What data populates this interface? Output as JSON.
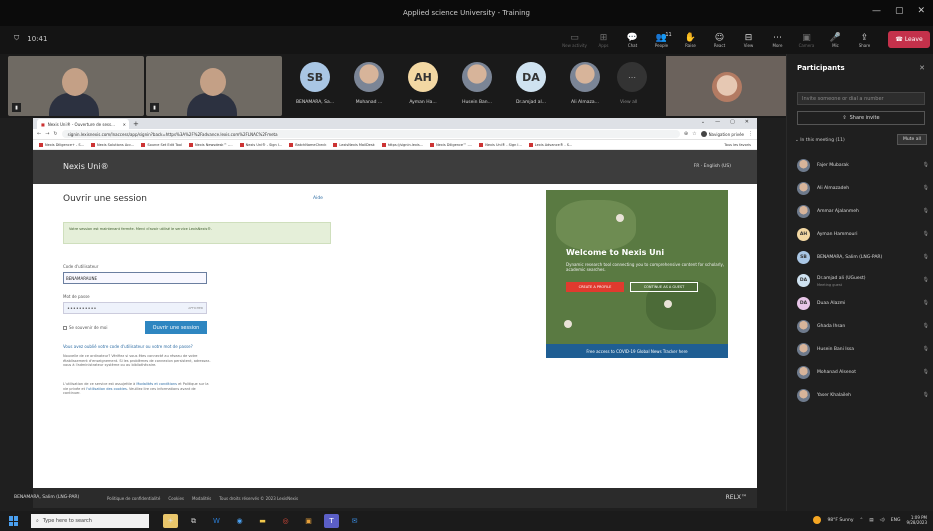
{
  "window": {
    "title": "Applied science University - Training",
    "controls": [
      "—",
      "▢",
      "✕"
    ]
  },
  "toolbar": {
    "timer": "10:41",
    "actions": [
      {
        "icon": "new-activity-icon",
        "glyph": "▭",
        "label": "New activity",
        "dim": true
      },
      {
        "icon": "apps-icon",
        "glyph": "⊞",
        "label": "Apps",
        "dim": true
      },
      {
        "icon": "chat-icon",
        "glyph": "💬",
        "label": "Chat",
        "dim": false
      },
      {
        "icon": "people-icon",
        "glyph": "👥",
        "label": "People",
        "dim": false
      },
      {
        "icon": "raise-hand-icon",
        "glyph": "✋",
        "label": "Raise",
        "dim": false
      },
      {
        "icon": "react-icon",
        "glyph": "☺",
        "label": "React",
        "dim": false
      },
      {
        "icon": "view-icon",
        "glyph": "⊟",
        "label": "View",
        "dim": false
      },
      {
        "icon": "more-icon",
        "glyph": "⋯",
        "label": "More",
        "dim": false
      },
      {
        "icon": "camera-icon",
        "glyph": "▣",
        "label": "Camera",
        "dim": true
      },
      {
        "icon": "mic-icon",
        "glyph": "🎤",
        "label": "Mic",
        "dim": false
      },
      {
        "icon": "share-icon",
        "glyph": "⇪",
        "label": "Share",
        "dim": false
      }
    ],
    "leave_label": "Leave",
    "people_count": "11"
  },
  "strip": {
    "tiles": [
      {
        "initials": "SB",
        "name": "BENAMARA, Sa...",
        "color": "#a9c6e4",
        "photo": false
      },
      {
        "initials": "",
        "name": "Mohanad ...",
        "color": "",
        "photo": true
      },
      {
        "initials": "AH",
        "name": "Ayman Ha...",
        "color": "#f3d8a3",
        "photo": false
      },
      {
        "initials": "",
        "name": "Husein Ban...",
        "color": "",
        "photo": true
      },
      {
        "initials": "DA",
        "name": "Dr.amjad al...",
        "color": "#cfe2f0",
        "photo": false
      },
      {
        "initials": "",
        "name": "Ali Almaza...",
        "color": "",
        "photo": true
      }
    ],
    "view_all": "View all"
  },
  "browser": {
    "tab_title": "Nexis Uni® - Ouverture de sess...",
    "url": "signin.lexisnexis.com/lnaccess/app/signin?back=https%3A%2F%2Fadvance.lexis.com%2FLNAC%2Fmeta",
    "private_label": "Navigation privée",
    "bookmarks": [
      "Nexis Diligence+ - S...",
      "Nexis Solutions Acc...",
      "Source Set Edit Tool",
      "Nexis Newsdesk™ -...",
      "Nexis Uni® - Sign I...",
      "BatchNameCheck",
      "LexisNexis MailDesk",
      "https://signin.lexis...",
      "Nexis Diligence™ -...",
      "Nexis Uni® - Sign I...",
      "Lexis Advance® - S..."
    ],
    "bookmarks_more": "Tous les favoris"
  },
  "nexis": {
    "logo": "Nexis Uni®",
    "lang": "FR · English (US)",
    "heading": "Ouvrir une session",
    "aide": "Aide",
    "notice": "Votre session est maintenant fermée. Merci d'avoir utilisé le service LexisNexis®.",
    "uid_label": "Code d'utilisateur",
    "uid_value": "BENAMARAUNE",
    "pwd_label": "Mot de passe",
    "pwd_value": "••••••••••",
    "pwd_toggle": "AFFICHER",
    "remember": "Se souvenir de moi",
    "submit": "Ouvrir une session",
    "forgot": "Vous avez oublié votre code d'utilisateur ou votre mot de passe?",
    "para1": "Nouvelle de ce ordinateur? Vérifiez si vous êtes connecté au réseau de votre établissement d'enseignement. Si les problèmes de connexion persistent, adressez-vous à l'administrateur système ou au bibliothécaire.",
    "para2_a": "L'utilisation de ce service est assujettie à ",
    "para2_link1": "Modalités et conditions",
    "para2_b": " et Politique sur la vie privée et ",
    "para2_link2": "l'utilisation des cookies",
    "para2_c": ". Veuillez lire ces informations avant de continuer."
  },
  "promo": {
    "title": "Welcome to Nexis Uni",
    "subtitle": "Dynamic research tool connecting you to comprehensive content for scholarly, academic searches.",
    "cta1": "CREATE A PROFILE",
    "cta2": "CONTINUE AS A GUEST",
    "footer": "Free access to COVID-19 Global News Tracker here"
  },
  "share_footer": {
    "presenter": "BENAMARA, Salim (LNG-PAR)",
    "links": [
      "Politique de confidentialité",
      "Cookies",
      "Modalités",
      "Tous droits réservés © 2023 LexisNexis"
    ],
    "brand": "RELX™"
  },
  "panel": {
    "title": "Participants",
    "invite_placeholder": "Invite someone or dial a number",
    "share_invite": "Share invite",
    "in_meeting": "In this meeting (11)",
    "mute_all": "Mute all",
    "people": [
      {
        "name": "Fajer Mubarak",
        "initials": "",
        "color": "",
        "guest": ""
      },
      {
        "name": "Ali Almazadeh",
        "initials": "",
        "color": "",
        "guest": ""
      },
      {
        "name": "Ammar Ajalanmeh",
        "initials": "",
        "color": "",
        "guest": ""
      },
      {
        "name": "Ayman Hammouri",
        "initials": "AH",
        "color": "#f3d8a3",
        "guest": ""
      },
      {
        "name": "BENAMARA, Salim (LNG-PAR)",
        "initials": "SB",
        "color": "#a9c6e4",
        "guest": ""
      },
      {
        "name": "Dr.amjad ali (UGuest)",
        "initials": "DA",
        "color": "#cfe2f0",
        "guest": "Meeting guest"
      },
      {
        "name": "Duaa Alazmi",
        "initials": "DA",
        "color": "#e8c6e8",
        "guest": ""
      },
      {
        "name": "Ghada Ihsan",
        "initials": "",
        "color": "",
        "guest": ""
      },
      {
        "name": "Husein Bani Issa",
        "initials": "",
        "color": "",
        "guest": ""
      },
      {
        "name": "Mohanad Alsenot",
        "initials": "",
        "color": "",
        "guest": ""
      },
      {
        "name": "Yaser Khalaileh",
        "initials": "",
        "color": "",
        "guest": ""
      }
    ]
  },
  "taskbar": {
    "search_placeholder": "Type here to search",
    "weather": "98°F Sunny",
    "lang": "ENG",
    "time": "1:09 PM",
    "date": "9/28/2023"
  }
}
